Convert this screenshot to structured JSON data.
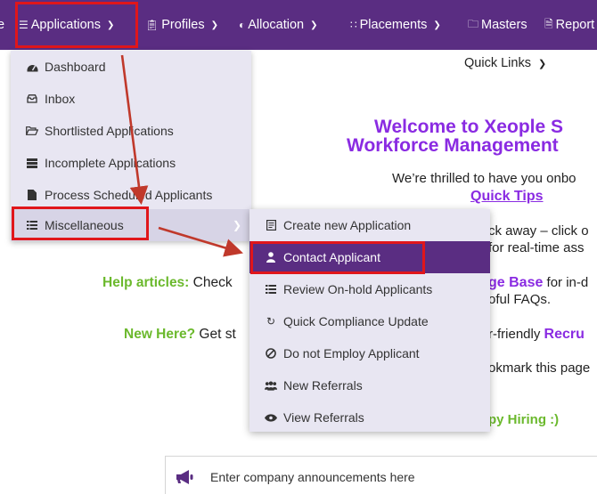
{
  "nav": {
    "edge_label": "e",
    "items": [
      {
        "label": "Applications",
        "icon": "list-icon"
      },
      {
        "label": "Profiles",
        "icon": "clipboard-icon"
      },
      {
        "label": "Allocation",
        "icon": "pie-icon"
      },
      {
        "label": "Placements",
        "icon": "sitemap-icon"
      },
      {
        "label": "Masters",
        "icon": "folder-icon"
      },
      {
        "label": "Report",
        "icon": "file-icon"
      }
    ]
  },
  "dropdown": {
    "items": [
      {
        "label": "Dashboard",
        "icon": "dashboard-icon"
      },
      {
        "label": "Inbox",
        "icon": "inbox-icon"
      },
      {
        "label": "Shortlisted Applications",
        "icon": "folder-open-icon"
      },
      {
        "label": "Incomplete Applications",
        "icon": "server-icon"
      },
      {
        "label": "Process Scheduled Applicants",
        "icon": "file-icon"
      },
      {
        "label": "Miscellaneous",
        "icon": "list-icon"
      }
    ]
  },
  "submenu": {
    "items": [
      {
        "label": "Create new Application",
        "icon": "form-icon"
      },
      {
        "label": "Contact Applicant",
        "icon": "user-icon"
      },
      {
        "label": "Review On-hold Applicants",
        "icon": "list-icon"
      },
      {
        "label": "Quick Compliance Update",
        "icon": "refresh-icon"
      },
      {
        "label": "Do not Employ Applicant",
        "icon": "ban-icon"
      },
      {
        "label": "New Referrals",
        "icon": "users-icon"
      },
      {
        "label": "View Referrals",
        "icon": "eye-icon"
      }
    ]
  },
  "content": {
    "quick_links": "Quick Links",
    "welcome_line1": "Welcome to Xeople S",
    "welcome_line2": "Workforce Management",
    "thrilled": "We’re thrilled to have you onbo",
    "quick_tips": "Quick Tips",
    "frag_away": "ck away – click o",
    "frag_realtime": "for real-time ass",
    "help_label": "Help articles:",
    "help_text": " Check",
    "frag_kb_bold": "ge Base",
    "frag_kb_text": " for in-d",
    "frag_faqs": "oful FAQs.",
    "new_label": "New Here?",
    "new_text": " Get st",
    "frag_friendly_text": "r-friendly ",
    "frag_friendly_bold": "Recru",
    "frag_bookmark": "okmark this page",
    "frag_hiring": "py Hiring :)",
    "announcement": "Enter company announcements here"
  },
  "colors": {
    "nav_bg": "#5a2d82",
    "accent_purple": "#8a2be2",
    "accent_green": "#6bb92d",
    "highlight_red": "#e0161b"
  }
}
